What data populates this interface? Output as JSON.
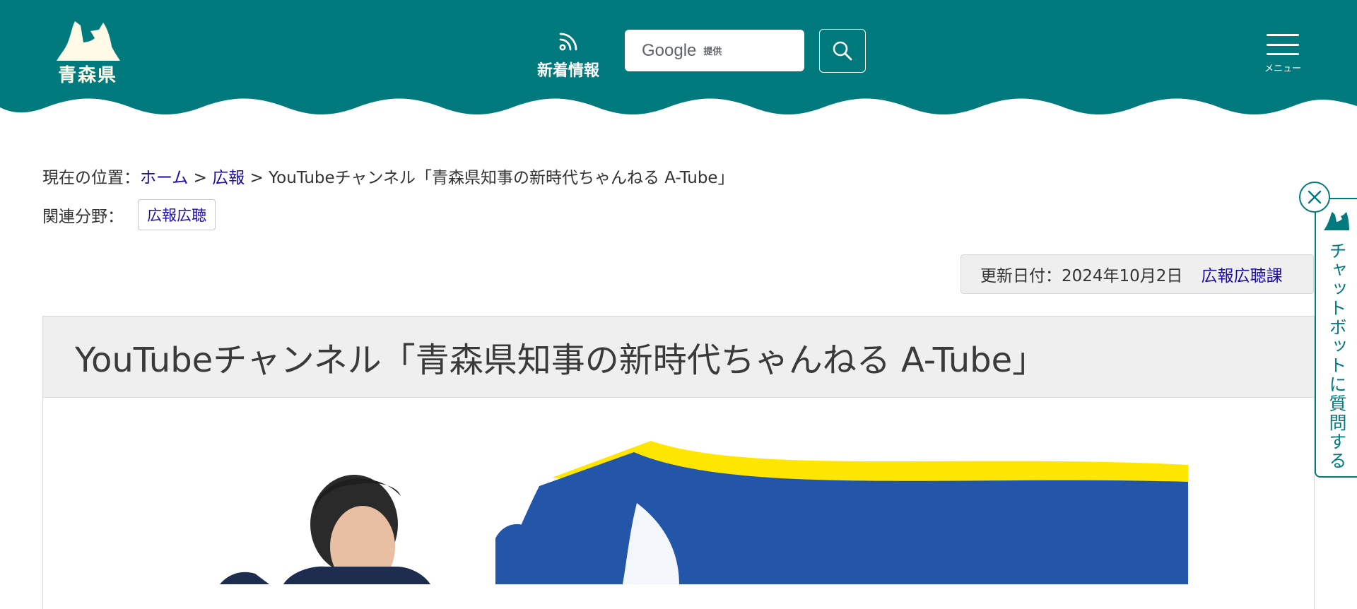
{
  "header": {
    "logo_text": "青森県",
    "news_label": "新着情報",
    "search": {
      "google_text": "Google",
      "provided_text": "提供"
    },
    "menu_label": "メニュー"
  },
  "breadcrumb": {
    "prefix": "現在の位置：",
    "home": "ホーム",
    "sep1": " > ",
    "pr": "広報",
    "sep2": " > ",
    "current": "YouTubeチャンネル「青森県知事の新時代ちゃんねる A-Tube」"
  },
  "related": {
    "label": "関連分野：",
    "tag": "広報広聴"
  },
  "update": {
    "date_text": "更新日付：2024年10月2日",
    "dept": "広報広聴課"
  },
  "page_title": "YouTubeチャンネル「青森県知事の新時代ちゃんねる A-Tube」",
  "chatbot": {
    "label": "チャットボットに質問する"
  },
  "colors": {
    "header": "#007a7c",
    "link": "#1a0dab",
    "banner_blue": "#2356a8",
    "banner_yellow": "#ffe600"
  }
}
